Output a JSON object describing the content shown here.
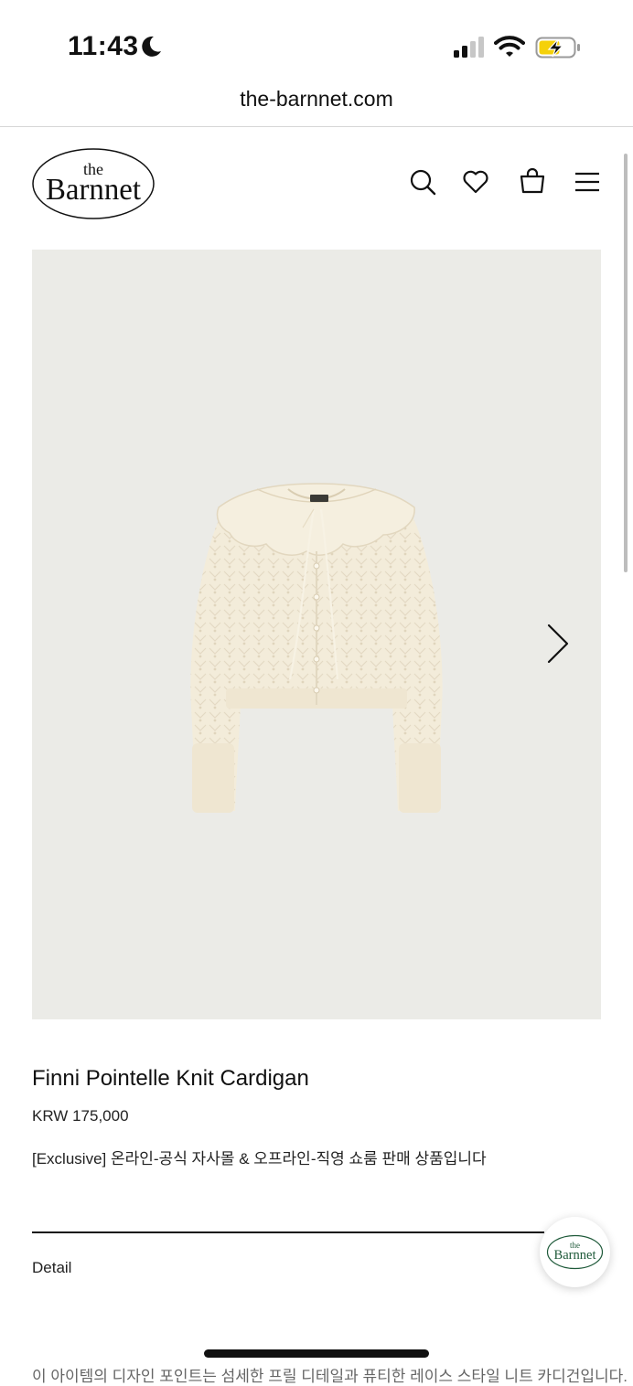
{
  "status_bar": {
    "time": "11:43",
    "battery_color": "#f5d10a"
  },
  "browser": {
    "url": "the-barnnet.com"
  },
  "header": {
    "logo": {
      "top": "the",
      "bottom": "Barnnet"
    },
    "icons": [
      "search-icon",
      "heart-icon",
      "shopping-bag-icon",
      "menu-icon"
    ]
  },
  "product": {
    "name": "Finni Pointelle Knit Cardigan",
    "price": "KRW 175,000",
    "description": "[Exclusive] 온라인-공식 자사몰 & 오프라인-직영 쇼룸 판매 상품입니다",
    "detail_label": "Detail",
    "garment_color": "#f3ecda"
  },
  "chat": {
    "logo_top": "the",
    "logo_bottom": "Barnnet",
    "logo_color": "#1f5a3a"
  },
  "footer": {
    "cut_text": "이 아이템의 디자인 포인트는 섬세한 프릴 디테일과 퓨티한 레이스 스타일 니트 카디건입니다."
  }
}
